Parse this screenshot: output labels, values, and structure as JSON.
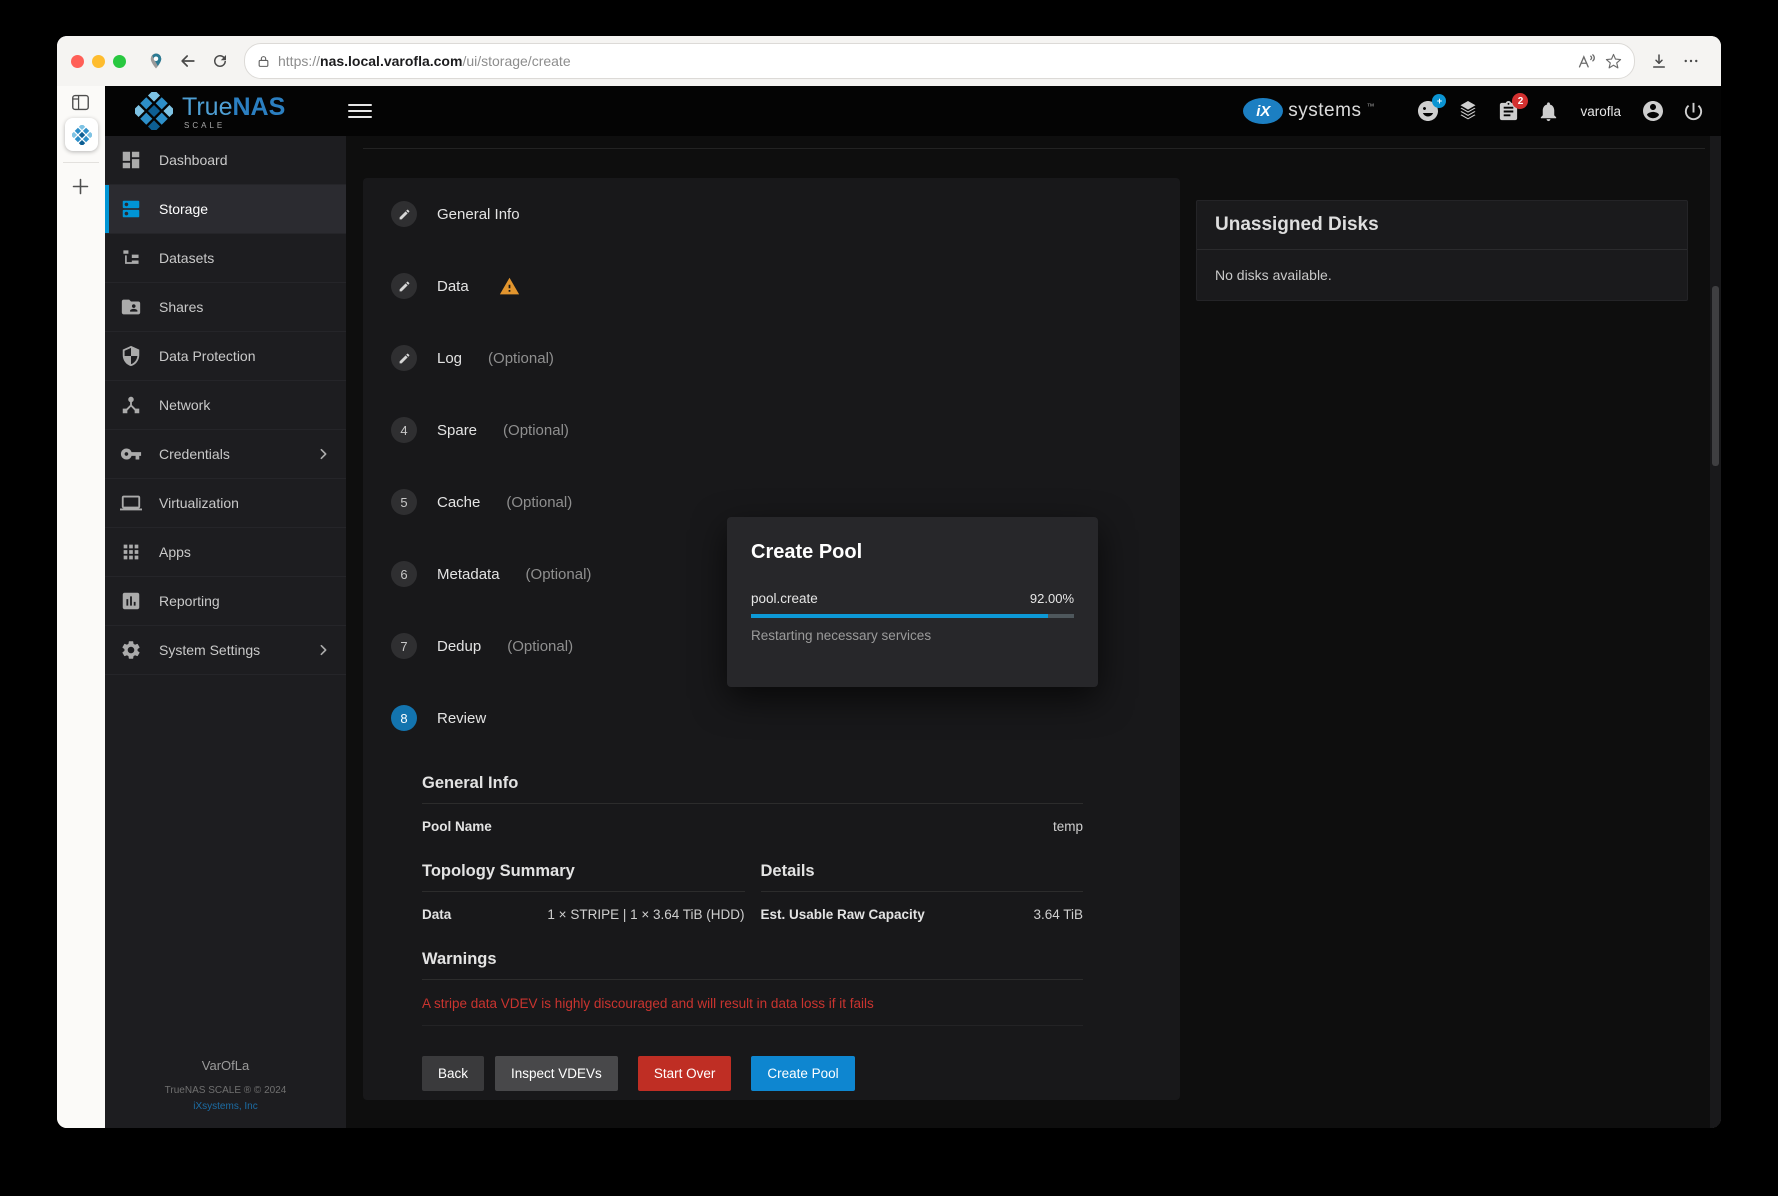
{
  "browser": {
    "url": {
      "scheme": "https://",
      "host": "nas.local.varofla.com",
      "path": "/ui/storage/create"
    }
  },
  "app_header": {
    "brand": {
      "true": "True",
      "nas": "NAS",
      "edition": "SCALE"
    },
    "vendor": {
      "ix": "iX",
      "name": "systems",
      "tm": "™"
    },
    "feedback_badge": "+",
    "jobs_badge": "2",
    "username": "varofla"
  },
  "sidebar": {
    "items": [
      {
        "label": "Dashboard",
        "icon": "dashboard-icon"
      },
      {
        "label": "Storage",
        "icon": "storage-icon",
        "active": true
      },
      {
        "label": "Datasets",
        "icon": "datasets-icon"
      },
      {
        "label": "Shares",
        "icon": "shares-icon"
      },
      {
        "label": "Data Protection",
        "icon": "shield-icon"
      },
      {
        "label": "Network",
        "icon": "network-icon"
      },
      {
        "label": "Credentials",
        "icon": "key-icon",
        "chevron": true
      },
      {
        "label": "Virtualization",
        "icon": "laptop-icon"
      },
      {
        "label": "Apps",
        "icon": "apps-icon"
      },
      {
        "label": "Reporting",
        "icon": "report-icon"
      },
      {
        "label": "System Settings",
        "icon": "gear-icon",
        "chevron": true
      }
    ],
    "footer": {
      "hostname": "VarOfLa",
      "copyright": "TrueNAS SCALE ® © 2024",
      "company": "iXsystems, Inc"
    }
  },
  "wizard": {
    "steps": [
      {
        "label": "General Info",
        "icon": "edit"
      },
      {
        "label": "Data",
        "icon": "edit",
        "warning": true
      },
      {
        "label": "Log",
        "optional": "(Optional)",
        "icon": "edit"
      },
      {
        "num": "4",
        "label": "Spare",
        "optional": "(Optional)"
      },
      {
        "num": "5",
        "label": "Cache",
        "optional": "(Optional)"
      },
      {
        "num": "6",
        "label": "Metadata",
        "optional": "(Optional)"
      },
      {
        "num": "7",
        "label": "Dedup",
        "optional": "(Optional)"
      },
      {
        "num": "8",
        "label": "Review",
        "active": true
      }
    ],
    "review": {
      "general_heading": "General Info",
      "pool_name_label": "Pool Name",
      "pool_name_value": "temp",
      "topology_heading": "Topology Summary",
      "details_heading": "Details",
      "data_label": "Data",
      "data_value": "1 × STRIPE | 1 × 3.64 TiB (HDD)",
      "capacity_label": "Est. Usable Raw Capacity",
      "capacity_value": "3.64 TiB",
      "warnings_heading": "Warnings",
      "warning_text": "A stripe data VDEV is highly discouraged and will result in data loss if it fails"
    },
    "buttons": {
      "back": "Back",
      "inspect": "Inspect VDEVs",
      "start_over": "Start Over",
      "create": "Create Pool"
    }
  },
  "dialog": {
    "title": "Create Pool",
    "job_name": "pool.create",
    "percent_label": "92.00%",
    "progress": 92,
    "status": "Restarting necessary services"
  },
  "unassigned": {
    "title": "Unassigned Disks",
    "empty": "No disks available."
  },
  "colors": {
    "accent": "#0095d5",
    "warning": "#e2952e",
    "error": "#c9342f",
    "create_button": "#0e86d0",
    "start_over_button": "#bf2e24"
  }
}
